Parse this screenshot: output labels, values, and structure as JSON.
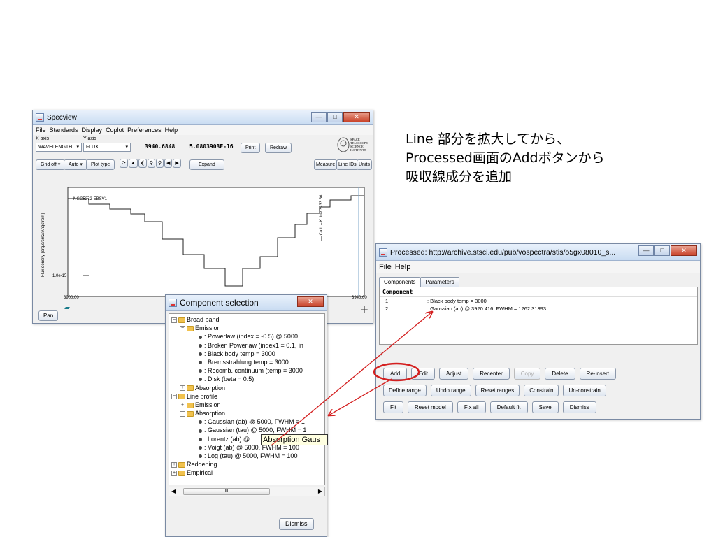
{
  "annotation": {
    "line1": "Line 部分を拡大してから、",
    "line2": "Processed画面のAddボタンから",
    "line3": "吸収線成分を追加"
  },
  "specview": {
    "title": "Specview",
    "menu": [
      "File",
      "Standards",
      "Display",
      "Coplot",
      "Preferences",
      "Help"
    ],
    "x_axis_label": "X axis",
    "y_axis_label": "Y axis",
    "x_axis_value": "WAVELENGTH",
    "y_axis_value": "FLUX",
    "cursor_x": "3940.6848",
    "cursor_y": "5.0803903E-16",
    "print_label": "Print",
    "redraw_label": "Redraw",
    "logo_text": "SPACE TELESCOPE SCIENCE INSTITUTE",
    "grid_label": "Grid off",
    "auto_label": "Auto",
    "plot_type_label": "Plot type",
    "expand_label": "Expand",
    "measure_label": "Measure",
    "lineids_label": "Line IDs",
    "units_label": "Units",
    "pan_label": "Pan",
    "plot": {
      "ylabel": "Flux density (erg/s/cm2/Angstrom)",
      "ytick": "1.0e-15",
      "xmin": "3900.00",
      "xmax": "3940.60",
      "spectrum_label": "NGC5272-EBSV1",
      "line_label": "— Ca II – K line 3933.66"
    }
  },
  "processed": {
    "title": "Processed: http://archive.stsci.edu/pub/vospectra/stis/o5gx08010_s...",
    "menu": [
      "File",
      "Help"
    ],
    "tabs": [
      "Components",
      "Parameters"
    ],
    "column_header": "Component",
    "components": [
      {
        "index": "1",
        "desc": ": Black body temp = 3000"
      },
      {
        "index": "2",
        "desc": ": Gaussian (ab) @ 3920.416, FWHM = 1262.31393"
      }
    ],
    "row1_buttons": [
      "Add",
      "Edit",
      "Adjust",
      "Recenter",
      "Copy",
      "Delete",
      "Re-insert"
    ],
    "row2_buttons": [
      "Define range",
      "Undo range",
      "Reset ranges",
      "Constrain",
      "Un-constrain"
    ],
    "row3_buttons": [
      "Fit",
      "Reset model",
      "Fix all",
      "Default fit",
      "Save",
      "Dismiss"
    ]
  },
  "component_selection": {
    "title": "Component selection",
    "tree": {
      "broad_band": "Broad band",
      "emission1": "Emission",
      "bb_emission_items": [
        ": Powerlaw (index = -0.5) @ 5000",
        ": Broken Powerlaw (index1 = 0.1, in",
        ": Black body temp = 3000",
        ": Bremsstrahlung  temp = 3000",
        ": Recomb. continuum (temp = 3000",
        ": Disk (beta = 0.5)"
      ],
      "absorption1": "Absorption",
      "line_profile": "Line profile",
      "emission2": "Emission",
      "absorption2": "Absorption",
      "lp_absorption_items": [
        ": Gaussian (ab) @ 5000, FWHM = 1",
        ": Gaussian (tau) @ 5000, FWHM = 1",
        ": Lorentz (ab) @",
        ": Voigt (ab) @ 5000, FWHM = 100",
        ": Log (tau) @ 5000, FWHM = 100"
      ],
      "reddening": "Reddening",
      "empirical": "Empirical"
    },
    "tooltip": "Absorption Gaus",
    "scroll_mid": "III",
    "dismiss_label": "Dismiss"
  },
  "colors": {
    "annotation_arrow": "#d42020",
    "highlight_oval": "#d42020"
  }
}
